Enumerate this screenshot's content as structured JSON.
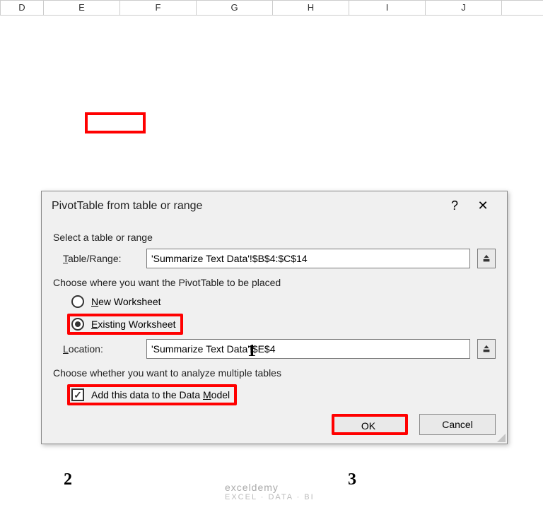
{
  "columns": [
    "D",
    "E",
    "F",
    "G",
    "H",
    "I",
    "J"
  ],
  "dialog": {
    "title": "PivotTable from table or range",
    "help": "?",
    "close": "✕",
    "select_label": "Select a table or range",
    "table_range_label_pre": "T",
    "table_range_label_u": "",
    "table_range_label": "Table/Range:",
    "table_range_value": "'Summarize Text Data'!$B$4:$C$14",
    "placement_label": "Choose where you want the PivotTable to be placed",
    "new_ws_label": "New Worksheet",
    "existing_ws_label": "Existing Worksheet",
    "location_label": "Location:",
    "location_value": "'Summarize Text Data'!$E$4",
    "multi_label": "Choose whether you want to analyze multiple tables",
    "add_model_label": "Add this data to the Data Model",
    "ok": "OK",
    "cancel": "Cancel"
  },
  "annotations": {
    "a1": "1",
    "a2": "2",
    "a3": "3"
  },
  "watermark": {
    "brand": "exceldemy",
    "sub": "EXCEL · DATA · BI"
  }
}
